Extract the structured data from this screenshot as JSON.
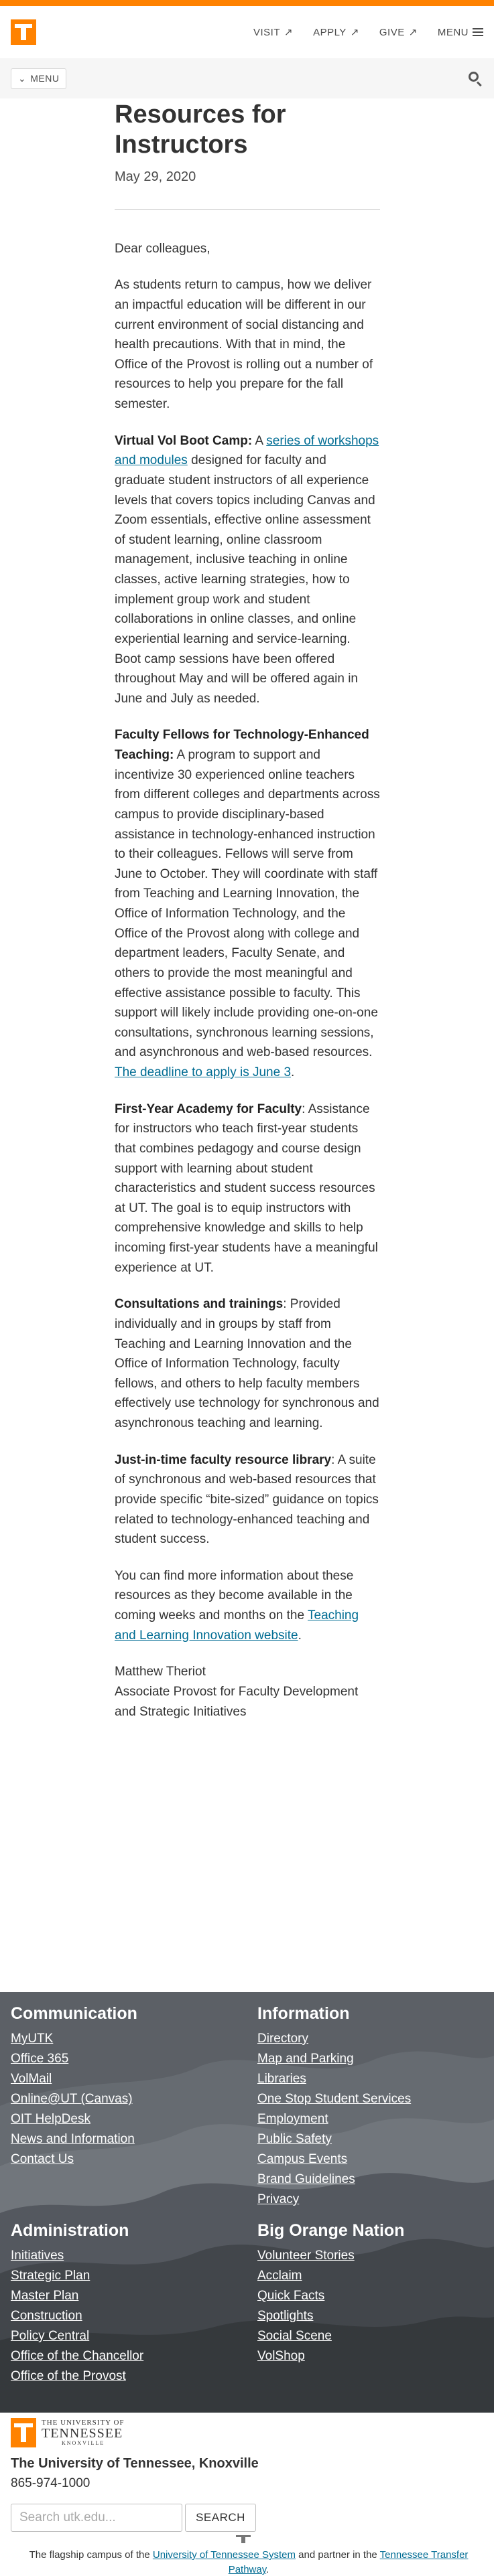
{
  "header": {
    "nav": [
      {
        "label": "VISIT",
        "arrow": "↗"
      },
      {
        "label": "APPLY",
        "arrow": "↗"
      },
      {
        "label": "GIVE",
        "arrow": "↗"
      },
      {
        "label": "MENU"
      }
    ],
    "menu_label": "MENU"
  },
  "article": {
    "title": "Resources for Instructors",
    "date": "May 29, 2020",
    "greeting": "Dear colleagues,",
    "intro": "As students return to campus, how we deliver an impactful education will be different in our current environment of social distancing and health precautions. With that in mind, the Office of the Provost is rolling out a number of resources to help you prepare for the fall semester.",
    "p1_head": "Virtual Vol Boot Camp:",
    "p1_pre": " A ",
    "p1_link": "series of workshops and modules",
    "p1_post": " designed for faculty and graduate student instructors of all experience levels that covers topics including Canvas and Zoom essentials, effective online assessment of student learning, online classroom management, inclusive teaching in online classes, active learning strategies, how to implement group work and student collaborations in online classes, and online experiential learning and service-learning. Boot camp sessions have been offered throughout May and will be offered again in June and July as needed.",
    "p2_head": "Faculty Fellows for Technology-Enhanced Teaching:",
    "p2_body": " A program to support and incentivize 30 experienced online teachers from different colleges and departments across campus to provide disciplinary-based assistance in technology-enhanced instruction to their colleagues. Fellows will serve from June to October. They will coordinate with staff from Teaching and Learning Innovation, the Office of Information Technology, and the Office of the Provost along with college and department leaders, Faculty Senate, and others to provide the most meaningful and effective assistance possible to faculty. This support will likely include providing one-on-one consultations, synchronous learning sessions, and asynchronous and web-based resources. ",
    "p2_link": "The deadline to apply is June 3",
    "p2_end": ".",
    "p3_head": "First-Year Academy for Faculty",
    "p3_body": ": Assistance for instructors who teach first-year students that combines pedagogy and course design support with learning about student characteristics and student success resources at UT. The goal is to equip instructors with comprehensive knowledge and skills to help incoming first-year students have a meaningful experience at UT.",
    "p4_head": "Consultations and trainings",
    "p4_body": ": Provided individually and in groups by staff from Teaching and Learning Innovation and the Office of Information Technology, faculty fellows, and others to help faculty members effectively use technology for synchronous and asynchronous teaching and learning.",
    "p5_head": "Just-in-time faculty resource library",
    "p5_body": ": A suite of synchronous and web-based resources that provide specific “bite-sized” guidance on topics related to technology-enhanced teaching and student success.",
    "p6_pre": "You can find more information about these resources as they become available in the coming weeks and months on the ",
    "p6_link": "Teaching and Learning Innovation website",
    "p6_end": ".",
    "sig_name": "Matthew Theriot",
    "sig_title": "Associate Provost for Faculty Development and Strategic Initiatives"
  },
  "footer": {
    "communication": {
      "heading": "Communication",
      "links": [
        "MyUTK",
        "Office 365",
        "VolMail",
        "Online@UT (Canvas)",
        "OIT HelpDesk",
        "News and Information",
        "Contact Us"
      ]
    },
    "information": {
      "heading": "Information",
      "links": [
        "Directory",
        "Map and Parking",
        "Libraries",
        "One Stop Student Services",
        "Employment",
        "Public Safety",
        "Campus Events",
        "Brand Guidelines",
        "Privacy"
      ]
    },
    "administration": {
      "heading": "Administration",
      "links": [
        "Initiatives",
        "Strategic Plan",
        "Master Plan",
        "Construction",
        "Policy Central",
        "Office of the Chancellor",
        "Office of the Provost"
      ]
    },
    "big_orange": {
      "heading": "Big Orange Nation",
      "links": [
        "Volunteer Stories",
        "Acclaim",
        "Quick Facts",
        "Spotlights",
        "Social Scene",
        "VolShop"
      ]
    }
  },
  "bottom": {
    "logo_line1": "THE UNIVERSITY OF",
    "logo_line2": "TENNESSEE",
    "logo_line3": "KNOXVILLE",
    "university_name": "The University of Tennessee, Knoxville",
    "phone": "865-974-1000",
    "search_placeholder": "Search utk.edu...",
    "search_button": "SEARCH",
    "flagship_pre": "The flagship campus of the ",
    "flagship_link1": "University of Tennessee System",
    "flagship_mid": " and partner in the ",
    "flagship_link2": "Tennessee Transfer Pathway",
    "flagship_end": "."
  },
  "colors": {
    "brand_orange": "#ff8200",
    "link_blue": "#006c93",
    "footer_gray": "#58595b"
  }
}
